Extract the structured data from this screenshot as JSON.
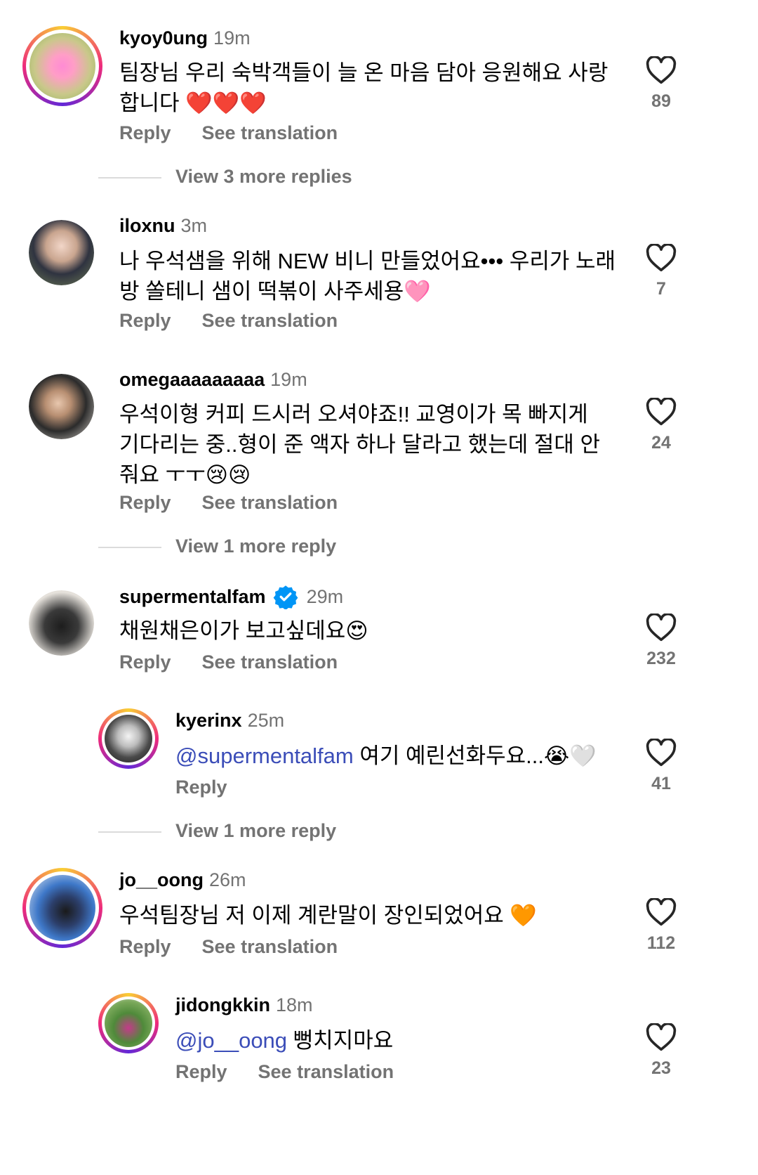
{
  "ui": {
    "reply_label": "Reply",
    "translate_label": "See translation"
  },
  "comments": [
    {
      "username": "kyoy0ung",
      "time": "19m",
      "text": "팀장님 우리 숙박객들이 늘 온 마음 담아 응원해요 사랑합니다 ❤️❤️❤️",
      "likes": "89"
    },
    {
      "username": "iloxnu",
      "time": "3m",
      "text": "나 우석샘을 위해 NEW 비니 만들었어요••• 우리가 노래방 쏠테니 샘이 떡볶이 사주세용🩷",
      "likes": "7"
    },
    {
      "username": "omegaaaaaaaaa",
      "time": "19m",
      "text": "우석이형 커피 드시러 오셔야죠!! 교영이가 목 빠지게 기다리는 중..형이 준 액자 하나 달라고 했는데 절대 안줘요 ㅜㅜ😢😢",
      "likes": "24"
    },
    {
      "username": "supermentalfam",
      "time": "29m",
      "text": "채원채은이가 보고싶데요😍",
      "likes": "232"
    },
    {
      "username": "kyerinx",
      "time": "25m",
      "mention": "@supermentalfam",
      "text": " 여기 예린선화두요...😭🤍",
      "likes": "41"
    },
    {
      "username": "jo__oong",
      "time": "26m",
      "text": "우석팀장님 저 이제 계란말이 장인되었어요 🧡",
      "likes": "112"
    },
    {
      "username": "jidongkkin",
      "time": "18m",
      "mention": "@jo__oong",
      "text": " 뻥치지마요",
      "likes": "23"
    }
  ],
  "view_more": [
    "View 3 more replies",
    "View 1 more reply",
    "View 1 more reply"
  ],
  "colors": {
    "mention": "#3b4db8",
    "verified": "#0095f6",
    "secondary_text": "#737373"
  },
  "icons": [
    "heart-outline-icon",
    "verified-badge-icon"
  ]
}
